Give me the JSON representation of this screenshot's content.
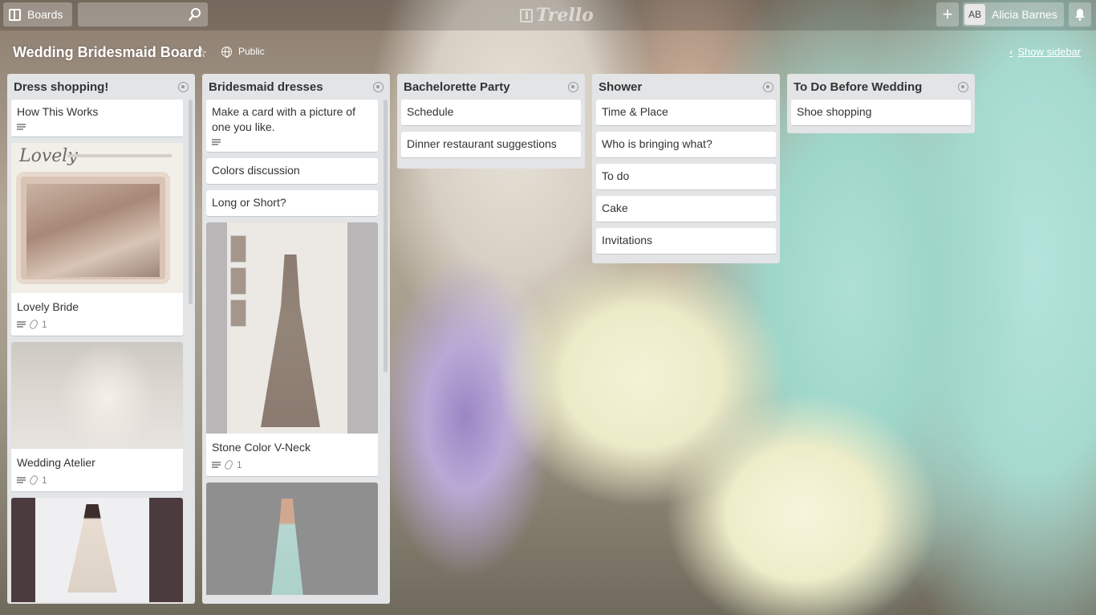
{
  "header": {
    "boards_label": "Boards",
    "search_value": "",
    "logo_text": "Trello",
    "add_label": "+",
    "user_initials": "AB",
    "user_name": "Alicia Barnes"
  },
  "board": {
    "title": "Wedding Bridesmaid Board",
    "visibility": "Public",
    "show_sidebar": "Show sidebar"
  },
  "lists": [
    {
      "title": "Dress shopping!",
      "cards": [
        {
          "title": "How This Works",
          "description": true
        },
        {
          "title": "Lovely Bride",
          "attachments": "1",
          "cover": "lovely"
        },
        {
          "title": "Wedding Atelier",
          "attachments": "1",
          "cover": "atelier"
        },
        {
          "title": "",
          "cover": "bride"
        }
      ]
    },
    {
      "title": "Bridesmaid dresses",
      "cards": [
        {
          "title": "Make a card with a picture of one you like.",
          "description": true
        },
        {
          "title": "Colors discussion"
        },
        {
          "title": "Long or Short?"
        },
        {
          "title": "Stone Color V-Neck",
          "attachments": "1",
          "cover": "stone"
        },
        {
          "title": "",
          "cover": "gray"
        }
      ]
    },
    {
      "title": "Bachelorette Party",
      "cards": [
        {
          "title": "Schedule"
        },
        {
          "title": "Dinner restaurant suggestions"
        }
      ]
    },
    {
      "title": "Shower",
      "cards": [
        {
          "title": "Time & Place"
        },
        {
          "title": "Who is bringing what?"
        },
        {
          "title": "To do"
        },
        {
          "title": "Cake"
        },
        {
          "title": "Invitations"
        }
      ]
    },
    {
      "title": "To Do Before Wedding",
      "cards": [
        {
          "title": "Shoe shopping"
        }
      ]
    }
  ],
  "icons": {
    "boards": "boards-icon",
    "search": "search-icon",
    "add": "plus-icon",
    "notifications": "bell-icon",
    "star": "star-icon",
    "visibility": "globe-icon",
    "sidebar": "chevron-left-icon",
    "list_menu": "list-menu-icon",
    "description": "description-icon",
    "attachment": "paperclip-icon"
  }
}
